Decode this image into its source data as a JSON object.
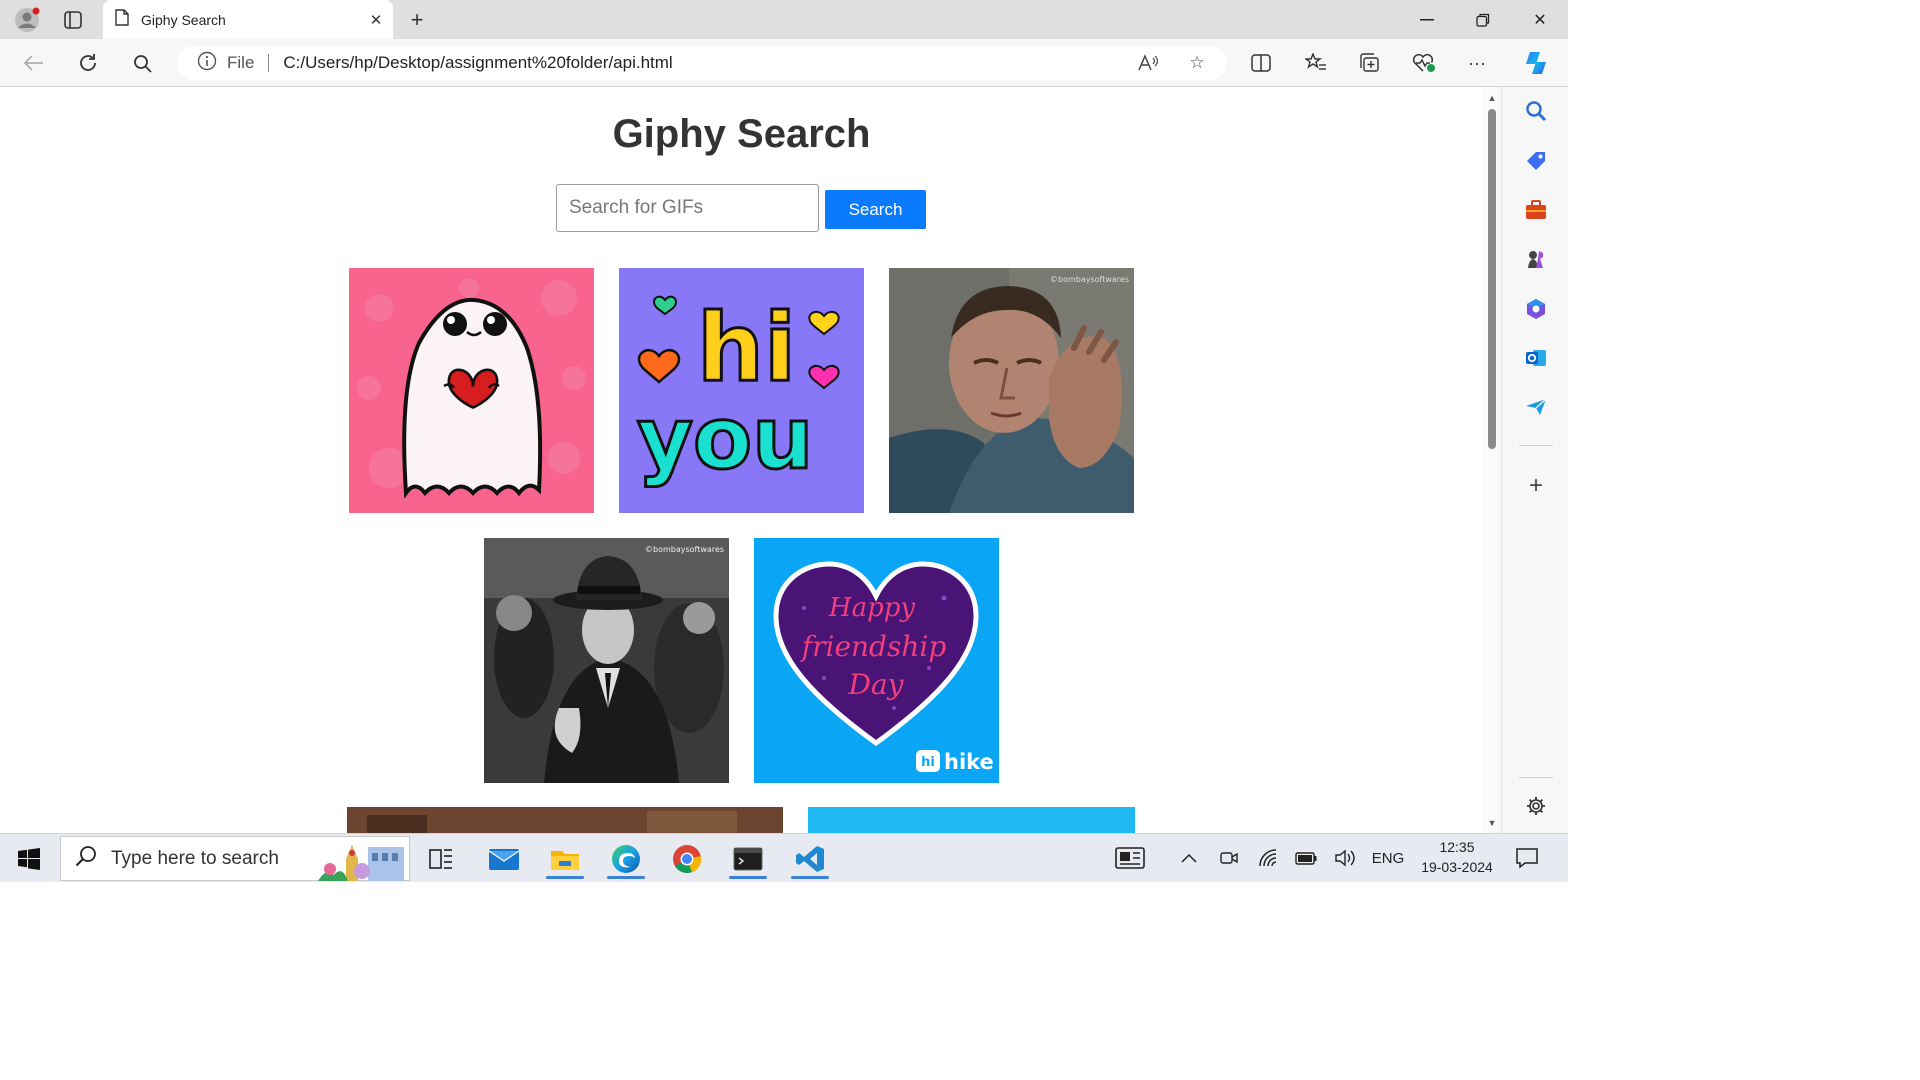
{
  "browser": {
    "tab_title": "Giphy Search",
    "address_scheme": "File",
    "address_url": "C:/Users/hp/Desktop/assignment%20folder/api.html"
  },
  "page": {
    "heading": "Giphy Search",
    "search_placeholder": "Search for GIFs",
    "search_button": "Search",
    "gifs": [
      {
        "name": "ghost-heart"
      },
      {
        "name": "hi-you",
        "text_line1": "hi",
        "text_line2": "you"
      },
      {
        "name": "man-thinking",
        "watermark": "©bombaysoftwares"
      },
      {
        "name": "man-in-hat",
        "watermark": "©bombaysoftwares"
      },
      {
        "name": "happy-friendship-day",
        "text_line1": "Happy",
        "text_line2": "friendship",
        "text_line3": "Day",
        "brand": "hike",
        "brand_badge": "hi"
      }
    ]
  },
  "taskbar": {
    "search_placeholder": "Type here to search",
    "language": "ENG",
    "time": "12:35",
    "date": "19-03-2024"
  },
  "colors": {
    "accent_button": "#0a7bff",
    "ghost_bg": "#f9648f",
    "hi_bg": "#8877f7",
    "friendship_bg": "#0aa5f5"
  }
}
